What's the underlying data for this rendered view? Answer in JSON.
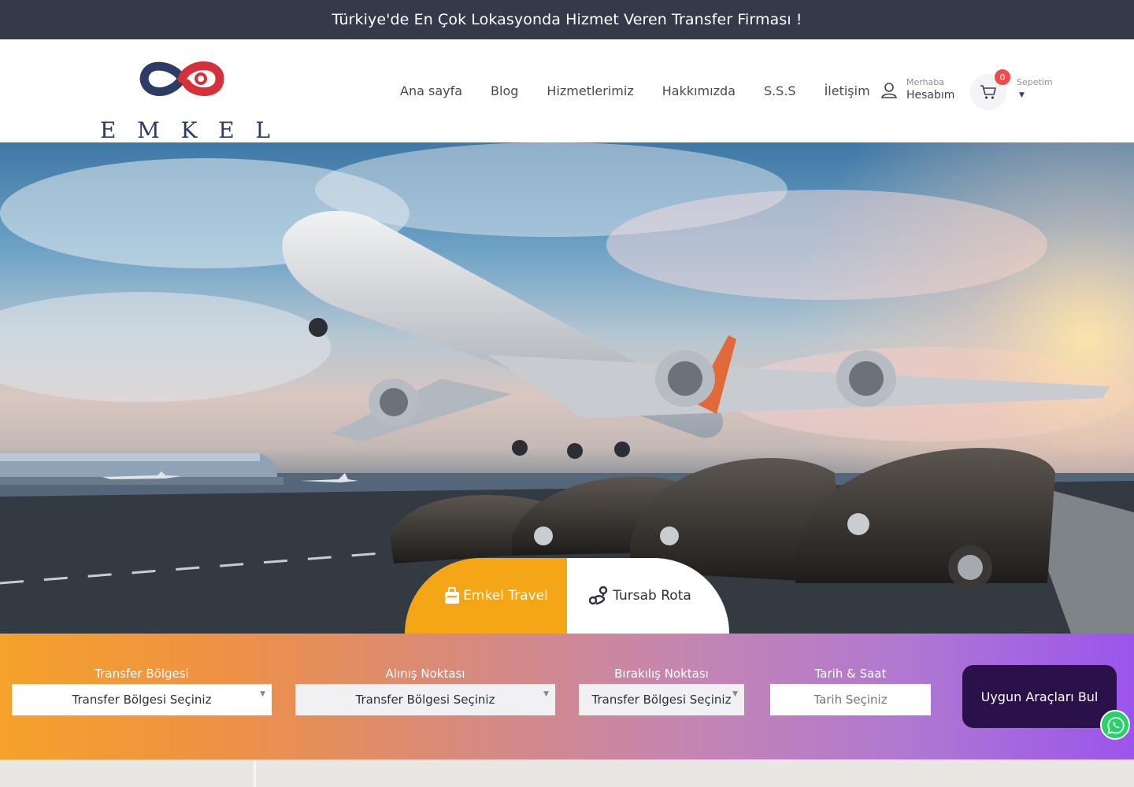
{
  "announcement": {
    "text": "Türkiye'de En Çok Lokasyonda Hizmet Veren Transfer Firması !"
  },
  "brand": {
    "name_letters": [
      "E",
      "M",
      "K",
      "E",
      "L"
    ],
    "colors": {
      "navy": "#2c3c66",
      "red": "#d6313b"
    }
  },
  "nav": {
    "items": [
      {
        "label": "Ana sayfa"
      },
      {
        "label": "Blog"
      },
      {
        "label": "Hizmetlerimiz"
      },
      {
        "label": "Hakkımızda"
      },
      {
        "label": "S.S.S"
      },
      {
        "label": "İletişim"
      }
    ]
  },
  "account": {
    "greeting": "Merhaba",
    "label": "Hesabım",
    "icon": "user-icon"
  },
  "cart": {
    "count": "0",
    "label": "Sepetim",
    "icon": "cart-icon"
  },
  "tabs": [
    {
      "label": "Emkel Travel",
      "icon": "suitcase-icon",
      "active": true,
      "color": "#f5a617"
    },
    {
      "label": "Tursab Rota",
      "icon": "route-icon",
      "active": false
    }
  ],
  "search": {
    "fields": [
      {
        "label": "Transfer Bölgesi",
        "value": "Transfer Bölgesi Seçiniz"
      },
      {
        "label": "Alınış Noktası",
        "value": "Transfer Bölgesi Seçiniz"
      },
      {
        "label": "Bırakılış Noktası",
        "value": "Transfer Bölgesi Seçiniz"
      },
      {
        "label": "Tarih & Saat",
        "placeholder": "Tarih Seçiniz"
      }
    ],
    "button_label": "Uygun Araçları Bul",
    "button_color": "#2a1149"
  },
  "colors": {
    "topbar": "#353a4b",
    "accent_orange": "#f5a617",
    "accent_purple": "#9a55ec"
  }
}
